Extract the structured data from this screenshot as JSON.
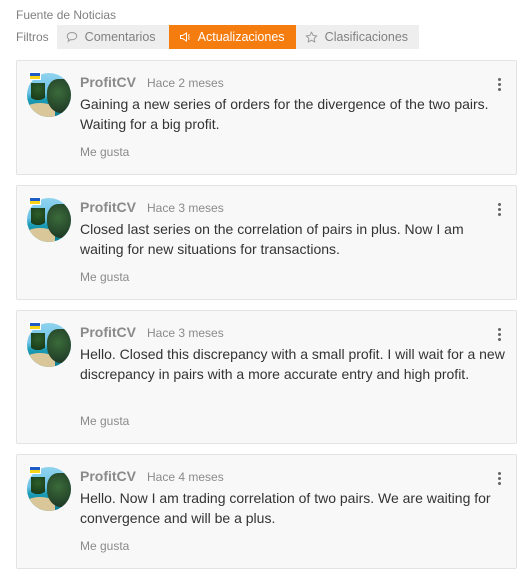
{
  "header": {
    "title": "Fuente de Noticias",
    "filters_label": "Filtros"
  },
  "tabs": [
    {
      "label": "Comentarios",
      "icon": "speech-bubble-icon",
      "active": false
    },
    {
      "label": "Actualizaciones",
      "icon": "megaphone-icon",
      "active": true
    },
    {
      "label": "Clasificaciones",
      "icon": "star-icon",
      "active": false
    }
  ],
  "colors": {
    "accent": "#f57c0f",
    "card_bg": "#f8f8f8",
    "muted_text": "#8a8a8a"
  },
  "posts": [
    {
      "author": "ProfitCV",
      "time": "Hace 2 meses",
      "text": "Gaining a new series of orders for the divergence of the two pairs. Waiting for a big profit.",
      "like_label": "Me gusta"
    },
    {
      "author": "ProfitCV",
      "time": "Hace 3 meses",
      "text": "Closed last series on the correlation of pairs in plus. Now I am waiting for new situations for transactions.",
      "like_label": "Me gusta"
    },
    {
      "author": "ProfitCV",
      "time": "Hace 3 meses",
      "text": "Hello. Closed this discrepancy with a small profit. I will wait for a new discrepancy in pairs with a more accurate entry and high profit.",
      "like_label": "Me gusta"
    },
    {
      "author": "ProfitCV",
      "time": "Hace 4 meses",
      "text": "Hello. Now I am trading correlation of two pairs. We are waiting for convergence and will be a plus.",
      "like_label": "Me gusta"
    }
  ]
}
